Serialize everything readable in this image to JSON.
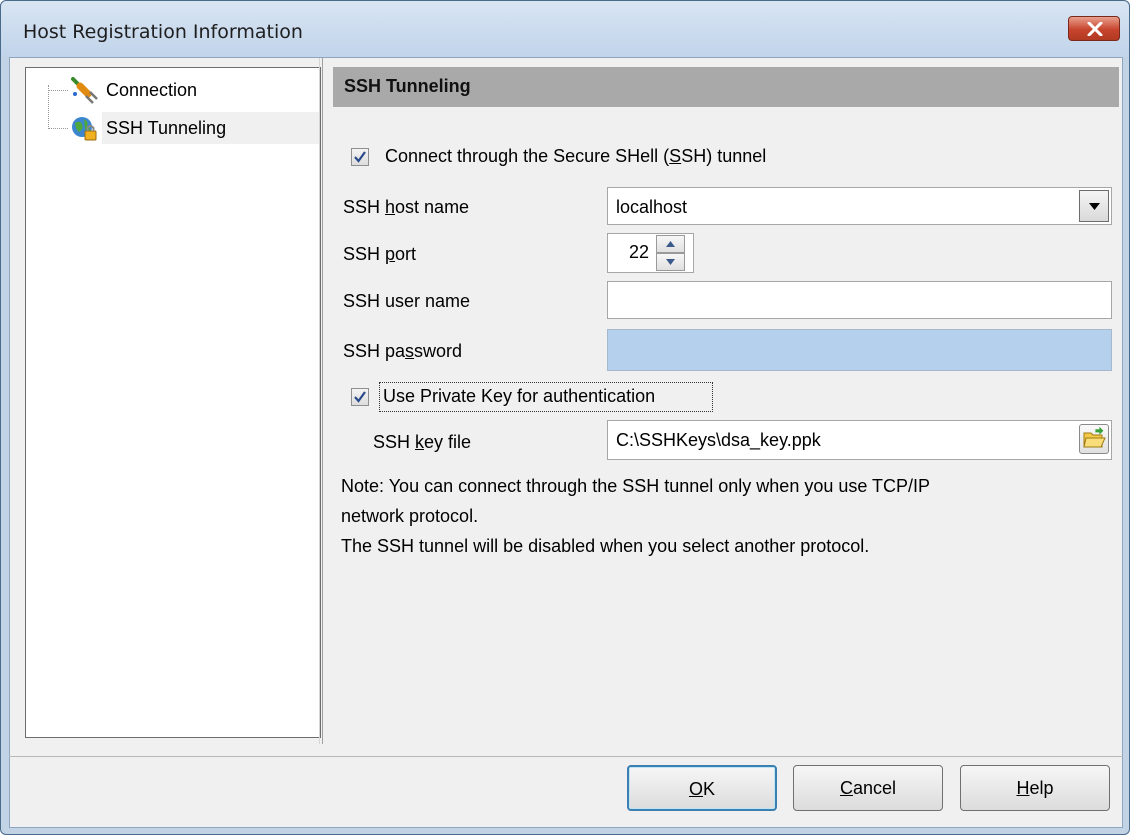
{
  "window": {
    "title": "Host Registration Information"
  },
  "tree": {
    "items": [
      {
        "label": "Connection",
        "icon": "plug-icon"
      },
      {
        "label": "SSH Tunneling",
        "icon": "globe-lock-icon",
        "selected": true
      }
    ]
  },
  "section": {
    "title": "SSH Tunneling"
  },
  "ssh": {
    "use_tunnel": {
      "label_pre": "Connect through the Secure SHell (",
      "label_ul": "S",
      "label_post": "SH) tunnel",
      "checked": true
    },
    "host": {
      "label_pre": "SSH ",
      "label_ul": "h",
      "label_post": "ost name",
      "value": "localhost"
    },
    "port": {
      "label_pre": "SSH ",
      "label_ul": "p",
      "label_post": "ort",
      "value": "22"
    },
    "user": {
      "label": "SSH user name",
      "value": ""
    },
    "password": {
      "label_pre": "SSH pa",
      "label_ul": "s",
      "label_post": "sword",
      "value": ""
    },
    "private_key": {
      "label": "Use Private Key for authentication",
      "checked": true
    },
    "key_file": {
      "label_pre": "SSH ",
      "label_ul": "k",
      "label_post": "ey file",
      "value": "C:\\SSHKeys\\dsa_key.ppk"
    },
    "note_lines": [
      "Note: You can connect through the SSH tunnel only when you use TCP/IP",
      "network protocol.",
      "The SSH tunnel will be disabled  when you select another protocol."
    ]
  },
  "buttons": {
    "ok": {
      "ul": "O",
      "rest": "K"
    },
    "cancel": {
      "ul": "C",
      "rest": "ancel"
    },
    "help": {
      "ul": "H",
      "rest": "elp"
    }
  },
  "colors": {
    "close_button": "#c7442d",
    "disabled_field": "#b5d0ec",
    "section_header": "#a9a9a9"
  }
}
